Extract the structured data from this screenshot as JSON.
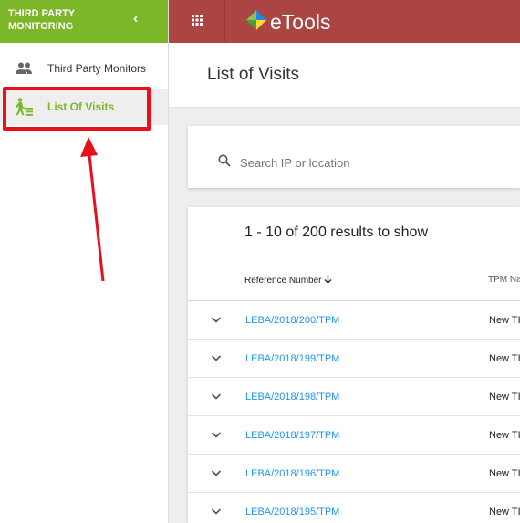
{
  "sidebar": {
    "title": "THIRD PARTY MONITORING",
    "items": [
      {
        "label": "Third Party Monitors",
        "icon": "people-icon"
      },
      {
        "label": "List Of Visits",
        "icon": "walking-person-icon",
        "active": true
      }
    ]
  },
  "topbar": {
    "app_name": "eTools",
    "apps_icon": "apps-grid-icon"
  },
  "page": {
    "title": "List of Visits"
  },
  "search": {
    "placeholder": "Search IP or location"
  },
  "results": {
    "summary": "1 - 10 of 200 results to show",
    "columns": [
      "Reference Number",
      "TPM Na"
    ],
    "rows": [
      {
        "ref": "LEBA/2018/200/TPM",
        "tpm": "New TI"
      },
      {
        "ref": "LEBA/2018/199/TPM",
        "tpm": "New TI"
      },
      {
        "ref": "LEBA/2018/198/TPM",
        "tpm": "New TI"
      },
      {
        "ref": "LEBA/2018/197/TPM",
        "tpm": "New TI"
      },
      {
        "ref": "LEBA/2018/196/TPM",
        "tpm": "New TI"
      },
      {
        "ref": "LEBA/2018/195/TPM",
        "tpm": "New TI"
      }
    ]
  },
  "colors": {
    "sidebar_header": "#7cb629",
    "topbar": "#ab4543",
    "link": "#2196f3",
    "annotation": "#e8101a"
  }
}
